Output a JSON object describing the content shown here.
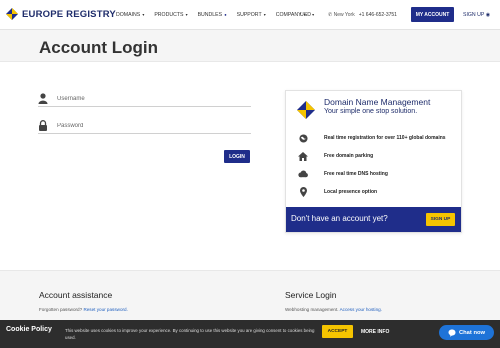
{
  "brand": {
    "name": "EUROPE REGISTRY",
    "colors": {
      "primary": "#1f2d8a",
      "accent": "#f5c400",
      "cookie_bg": "#2d2d2d",
      "chat": "#1e73d8"
    }
  },
  "nav": {
    "items": [
      {
        "label": "DOMAINS",
        "icon": "caret-down-icon"
      },
      {
        "label": "PRODUCTS",
        "icon": "caret-down-icon"
      },
      {
        "label": "BUNDLES",
        "icon": "bell-icon"
      },
      {
        "label": "SUPPORT",
        "icon": "caret-down-icon"
      },
      {
        "label": "COMPANY",
        "icon": "caret-down-icon"
      }
    ],
    "currency": "USD",
    "location": "New York",
    "phone": "+1 646-652-3751",
    "my_account": "MY ACCOUNT",
    "sign_up": "SIGN UP"
  },
  "page": {
    "title": "Account Login"
  },
  "login": {
    "username_placeholder": "Username",
    "password_placeholder": "Password",
    "submit": "LOGIN"
  },
  "promo": {
    "title": "Domain Name Management",
    "subtitle": "Your simple one stop solution.",
    "features": [
      {
        "text": "Real time registration for over 110+ global domains",
        "icon": "globe-icon"
      },
      {
        "text": "Free domain parking",
        "icon": "home-icon"
      },
      {
        "text": "Free real time DNS hosting",
        "icon": "cloud-icon"
      },
      {
        "text": "Local presence option",
        "icon": "map-pin-icon"
      }
    ],
    "footer_text": "Don't have an account yet?",
    "signup": "SIGN UP"
  },
  "footer": {
    "col1": {
      "heading": "Account assistance",
      "text": "Forgotten password?",
      "link": "Reset your password."
    },
    "col2": {
      "heading": "Service Login",
      "text": "Webhosting management.",
      "link": "Access your hosting."
    }
  },
  "cookie": {
    "title": "Cookie Policy",
    "text": "This website uses cookies to improve your experience. By continuing to use this website you are giving consent to cookies being used.",
    "accept": "ACCEPT",
    "more_info": "MORE INFO"
  },
  "chat": {
    "label": "Chat now"
  }
}
